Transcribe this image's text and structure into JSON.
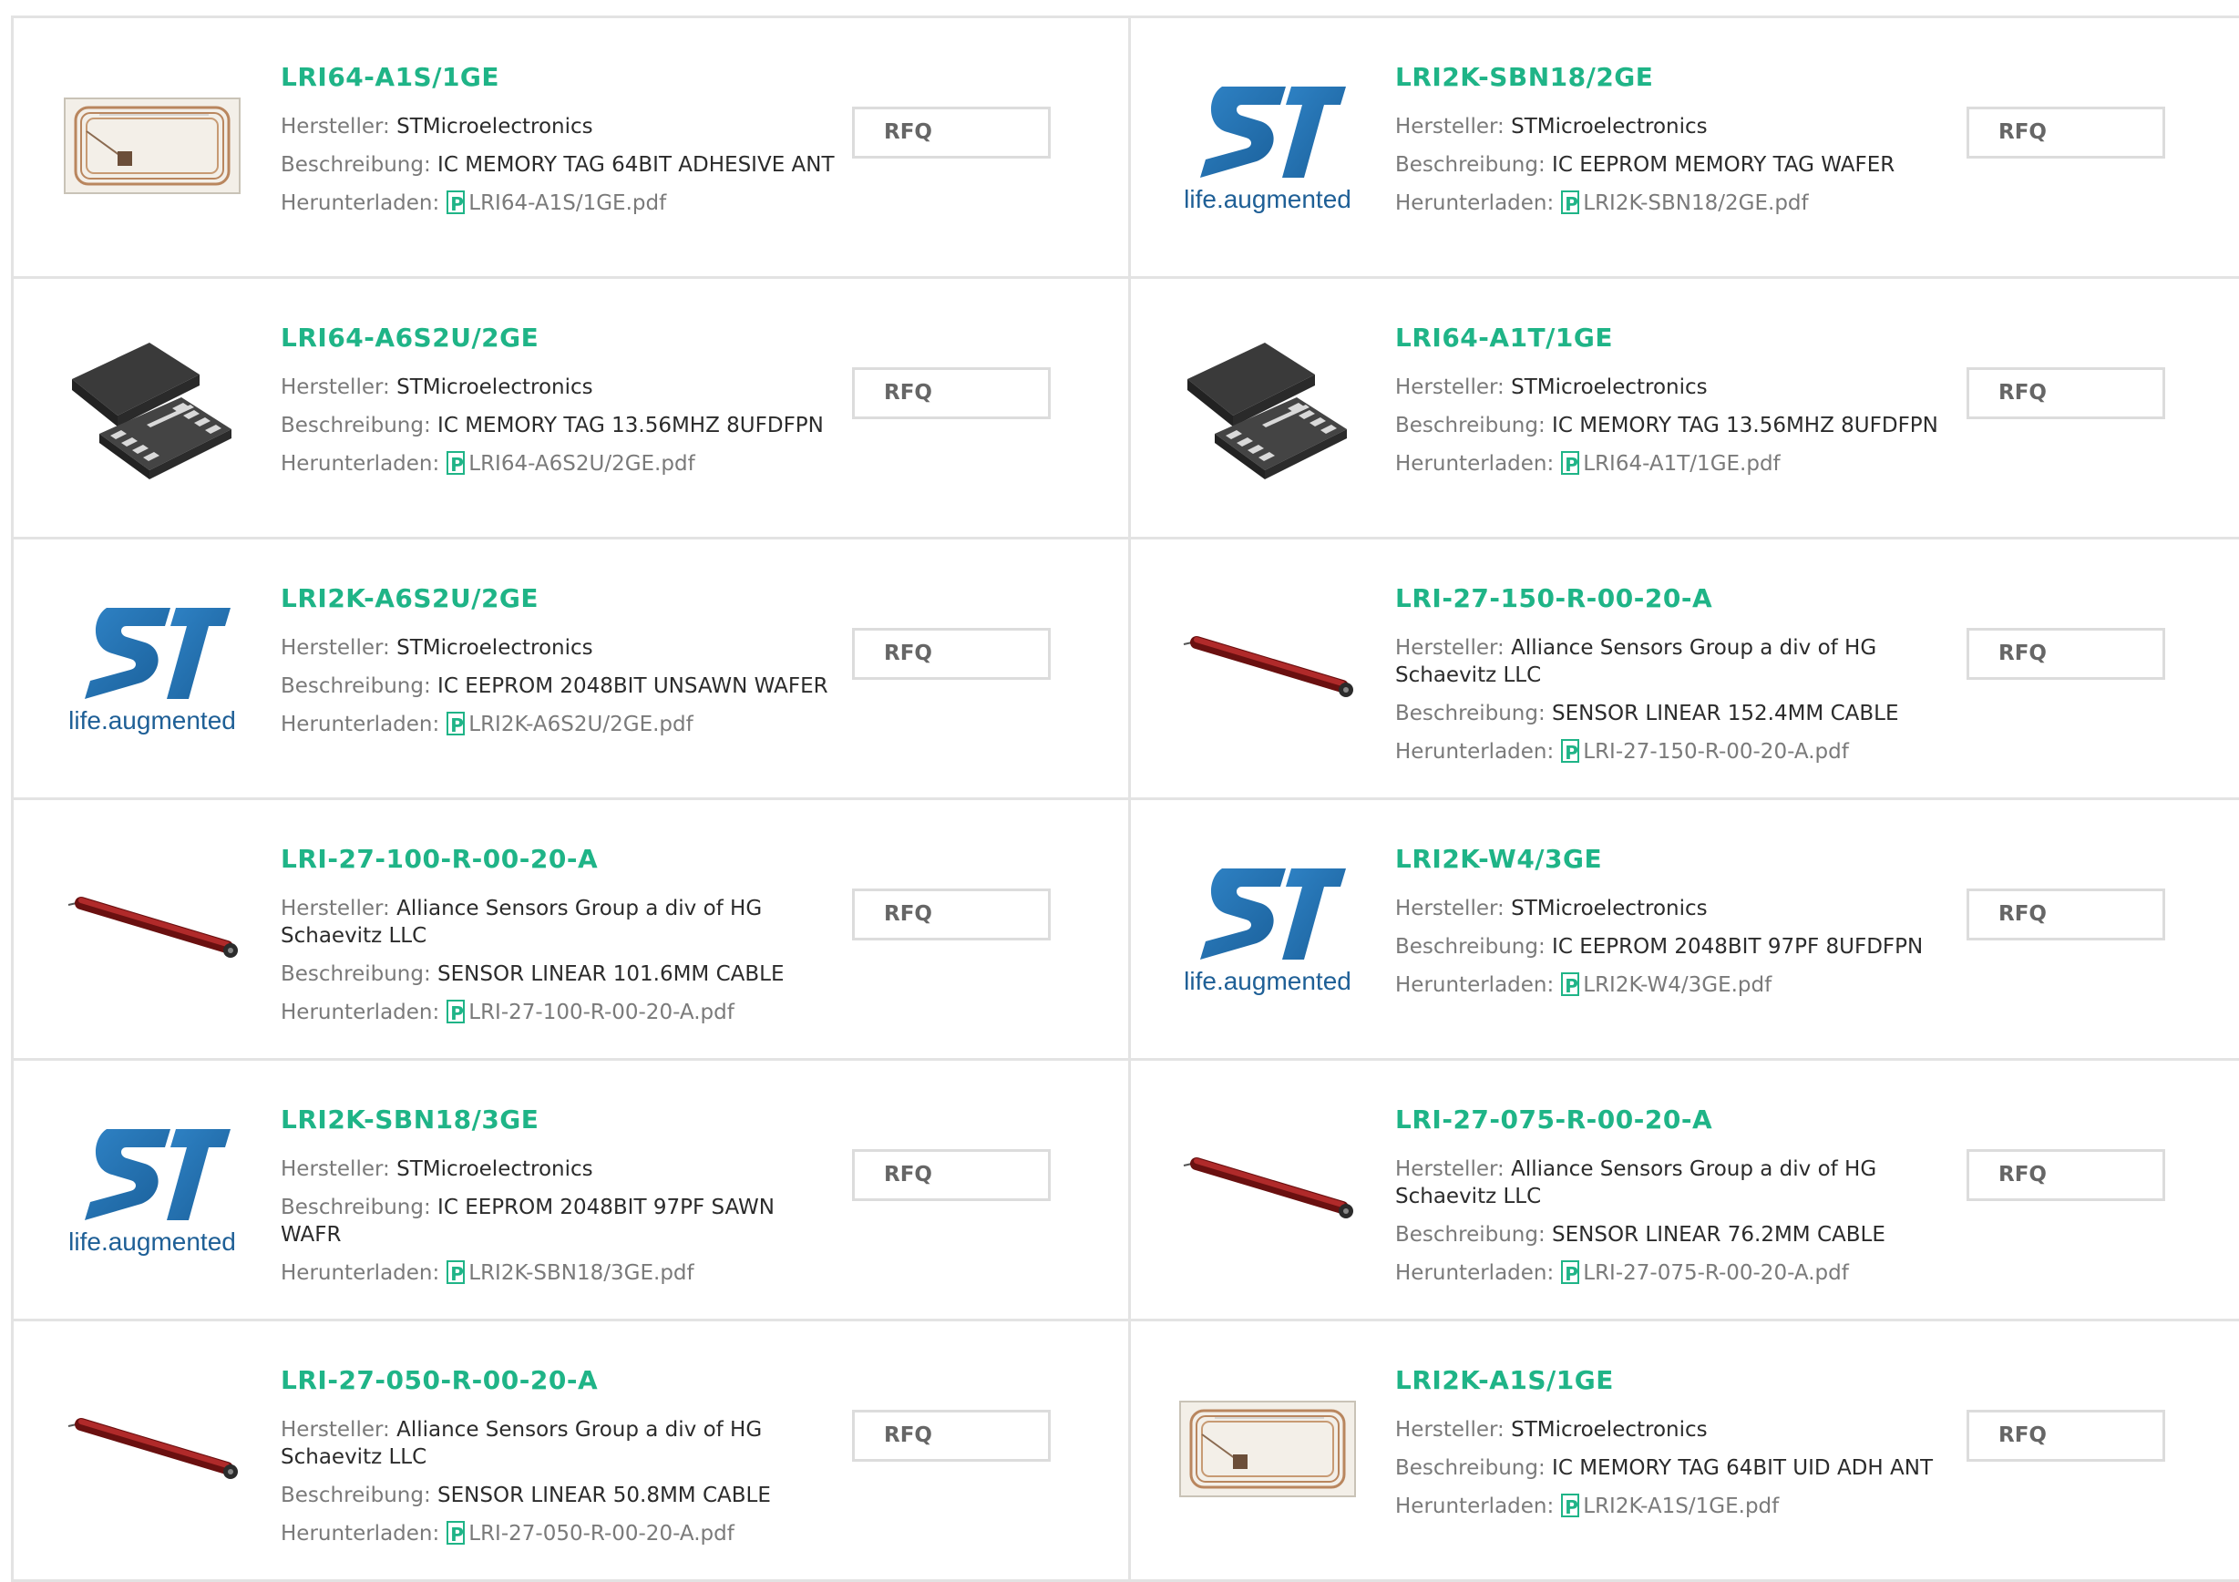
{
  "labels": {
    "manufacturer": "Hersteller:",
    "description": "Beschreibung:",
    "download": "Herunterladen:",
    "rfq": "RFQ"
  },
  "colors": {
    "accent": "#1fb487",
    "border": "#e3e3e3"
  },
  "products": [
    {
      "pn": "LRI64-A1S/1GE",
      "mfr": "STMicroelectronics",
      "desc": "IC MEMORY TAG 64BIT ADHESIVE ANT",
      "pdf": "LRI64-A1S/1GE.pdf",
      "img": "rfid-tag-icon"
    },
    {
      "pn": "LRI2K-SBN18/2GE",
      "mfr": "STMicroelectronics",
      "desc": "IC EEPROM MEMORY TAG WAFER",
      "pdf": "LRI2K-SBN18/2GE.pdf",
      "img": "st-logo-icon",
      "logo_tagline": "life.augmented"
    },
    {
      "pn": "LRI64-A6S2U/2GE",
      "mfr": "STMicroelectronics",
      "desc": "IC MEMORY TAG 13.56MHZ 8UFDFPN",
      "pdf": "LRI64-A6S2U/2GE.pdf",
      "img": "chip-package-icon"
    },
    {
      "pn": "LRI64-A1T/1GE",
      "mfr": "STMicroelectronics",
      "desc": "IC MEMORY TAG 13.56MHZ 8UFDFPN",
      "pdf": "LRI64-A1T/1GE.pdf",
      "img": "chip-package-icon"
    },
    {
      "pn": "LRI2K-A6S2U/2GE",
      "mfr": "STMicroelectronics",
      "desc": "IC EEPROM 2048BIT UNSAWN WAFER",
      "pdf": "LRI2K-A6S2U/2GE.pdf",
      "img": "st-logo-icon",
      "logo_tagline": "life.augmented"
    },
    {
      "pn": "LRI-27-150-R-00-20-A",
      "mfr": "Alliance Sensors Group a div of HG Schaevitz LLC",
      "desc": "SENSOR LINEAR 152.4MM CABLE",
      "pdf": "LRI-27-150-R-00-20-A.pdf",
      "img": "linear-sensor-icon"
    },
    {
      "pn": "LRI-27-100-R-00-20-A",
      "mfr": "Alliance Sensors Group a div of HG Schaevitz LLC",
      "desc": "SENSOR LINEAR 101.6MM CABLE",
      "pdf": "LRI-27-100-R-00-20-A.pdf",
      "img": "linear-sensor-icon"
    },
    {
      "pn": "LRI2K-W4/3GE",
      "mfr": "STMicroelectronics",
      "desc": "IC EEPROM 2048BIT 97PF 8UFDFPN",
      "pdf": "LRI2K-W4/3GE.pdf",
      "img": "st-logo-icon",
      "logo_tagline": "life.augmented"
    },
    {
      "pn": "LRI2K-SBN18/3GE",
      "mfr": "STMicroelectronics",
      "desc": "IC EEPROM 2048BIT 97PF SAWN WAFR",
      "pdf": "LRI2K-SBN18/3GE.pdf",
      "img": "st-logo-icon",
      "logo_tagline": "life.augmented"
    },
    {
      "pn": "LRI-27-075-R-00-20-A",
      "mfr": "Alliance Sensors Group a div of HG Schaevitz LLC",
      "desc": "SENSOR LINEAR 76.2MM CABLE",
      "pdf": "LRI-27-075-R-00-20-A.pdf",
      "img": "linear-sensor-icon"
    },
    {
      "pn": "LRI-27-050-R-00-20-A",
      "mfr": "Alliance Sensors Group a div of HG Schaevitz LLC",
      "desc": "SENSOR LINEAR 50.8MM CABLE",
      "pdf": "LRI-27-050-R-00-20-A.pdf",
      "img": "linear-sensor-icon"
    },
    {
      "pn": "LRI2K-A1S/1GE",
      "mfr": "STMicroelectronics",
      "desc": "IC MEMORY TAG 64BIT UID ADH ANT",
      "pdf": "LRI2K-A1S/1GE.pdf",
      "img": "rfid-tag-icon"
    }
  ]
}
